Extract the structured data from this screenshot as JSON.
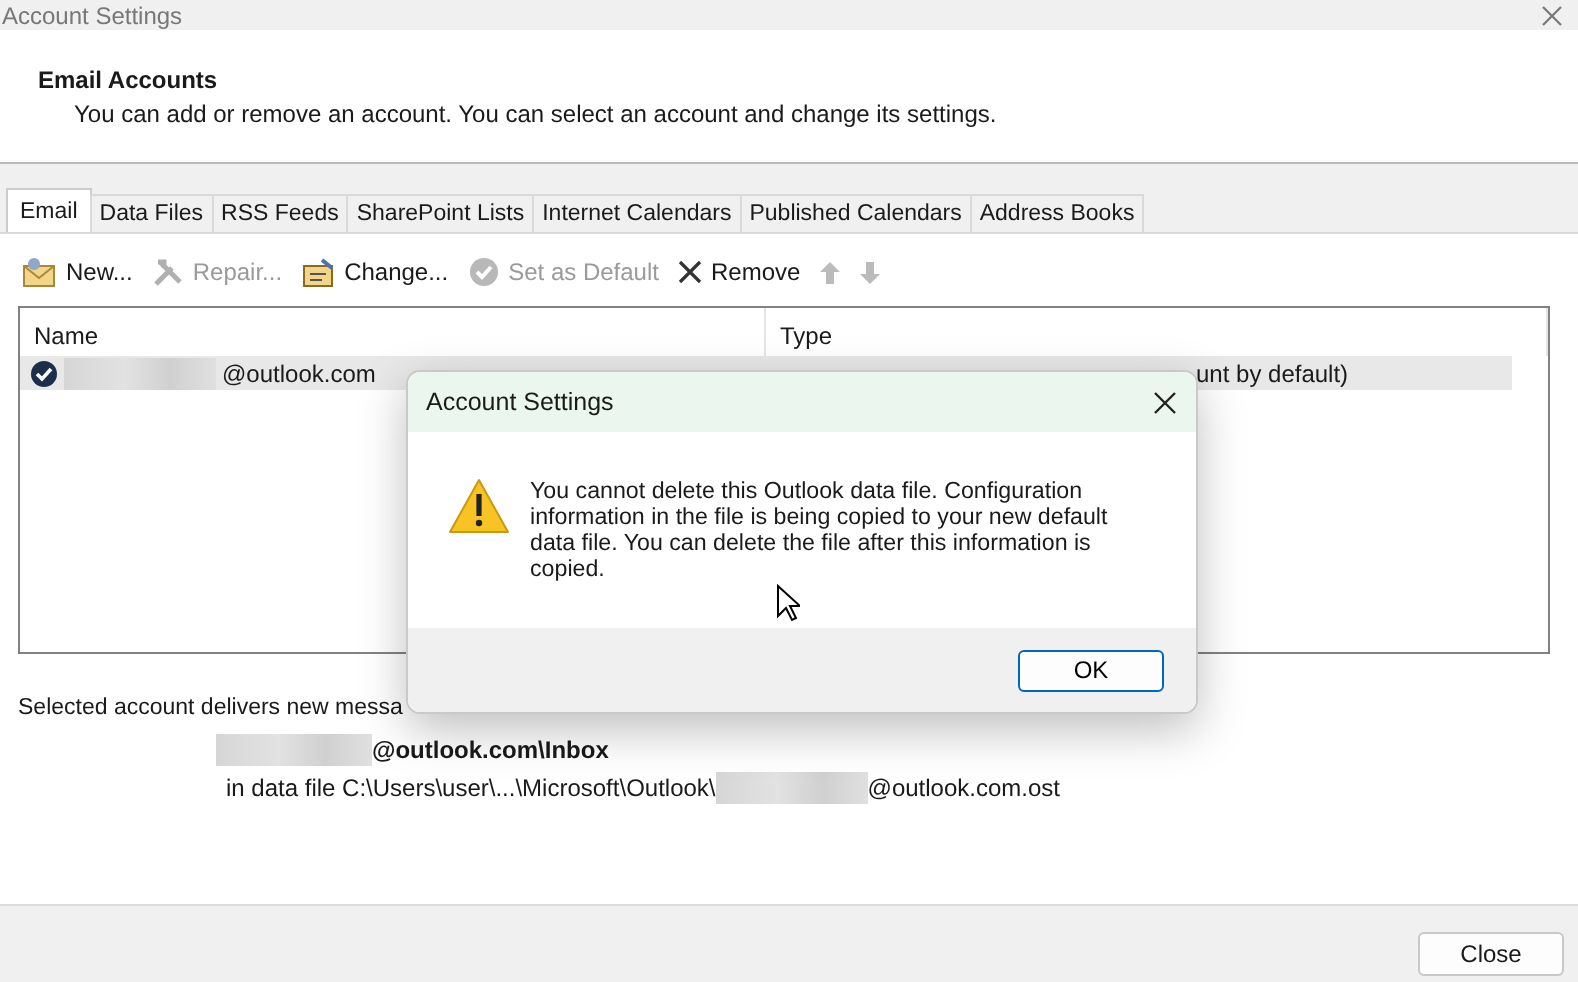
{
  "window": {
    "title": "Account Settings"
  },
  "header": {
    "title": "Email Accounts",
    "description": "You can add or remove an account. You can select an account and change its settings."
  },
  "tabs": [
    {
      "label": "Email",
      "selected": true
    },
    {
      "label": "Data Files",
      "selected": false
    },
    {
      "label": "RSS Feeds",
      "selected": false
    },
    {
      "label": "SharePoint Lists",
      "selected": false
    },
    {
      "label": "Internet Calendars",
      "selected": false
    },
    {
      "label": "Published Calendars",
      "selected": false
    },
    {
      "label": "Address Books",
      "selected": false
    }
  ],
  "toolbar": [
    {
      "kind": "new",
      "label": "New...",
      "disabled": false
    },
    {
      "kind": "repair",
      "label": "Repair...",
      "disabled": true
    },
    {
      "kind": "change",
      "label": "Change...",
      "disabled": false
    },
    {
      "kind": "default",
      "label": "Set as Default",
      "disabled": true
    },
    {
      "kind": "remove",
      "label": "Remove",
      "disabled": false
    },
    {
      "kind": "up",
      "disabled": true
    },
    {
      "kind": "down",
      "disabled": true
    }
  ],
  "table": {
    "columns": [
      "Name",
      "Type"
    ],
    "rows": [
      {
        "name": "@outlook.com",
        "type": "unt by default)",
        "selected": true,
        "default": true
      }
    ]
  },
  "delivery": {
    "text": "Selected account delivers new messa",
    "folder": "@outlook.com\\Inbox",
    "path_prefix": "in data file C:\\Users\\user\\...\\Microsoft\\Outlook\\",
    "path_suffix": "@outlook.com.ost"
  },
  "close_button": "Close",
  "dialog": {
    "title": "Account Settings",
    "message": "You cannot delete this Outlook data file. Configuration information in the file is being copied to your new default data file. You can delete the file after this information is copied.",
    "button": "OK"
  }
}
